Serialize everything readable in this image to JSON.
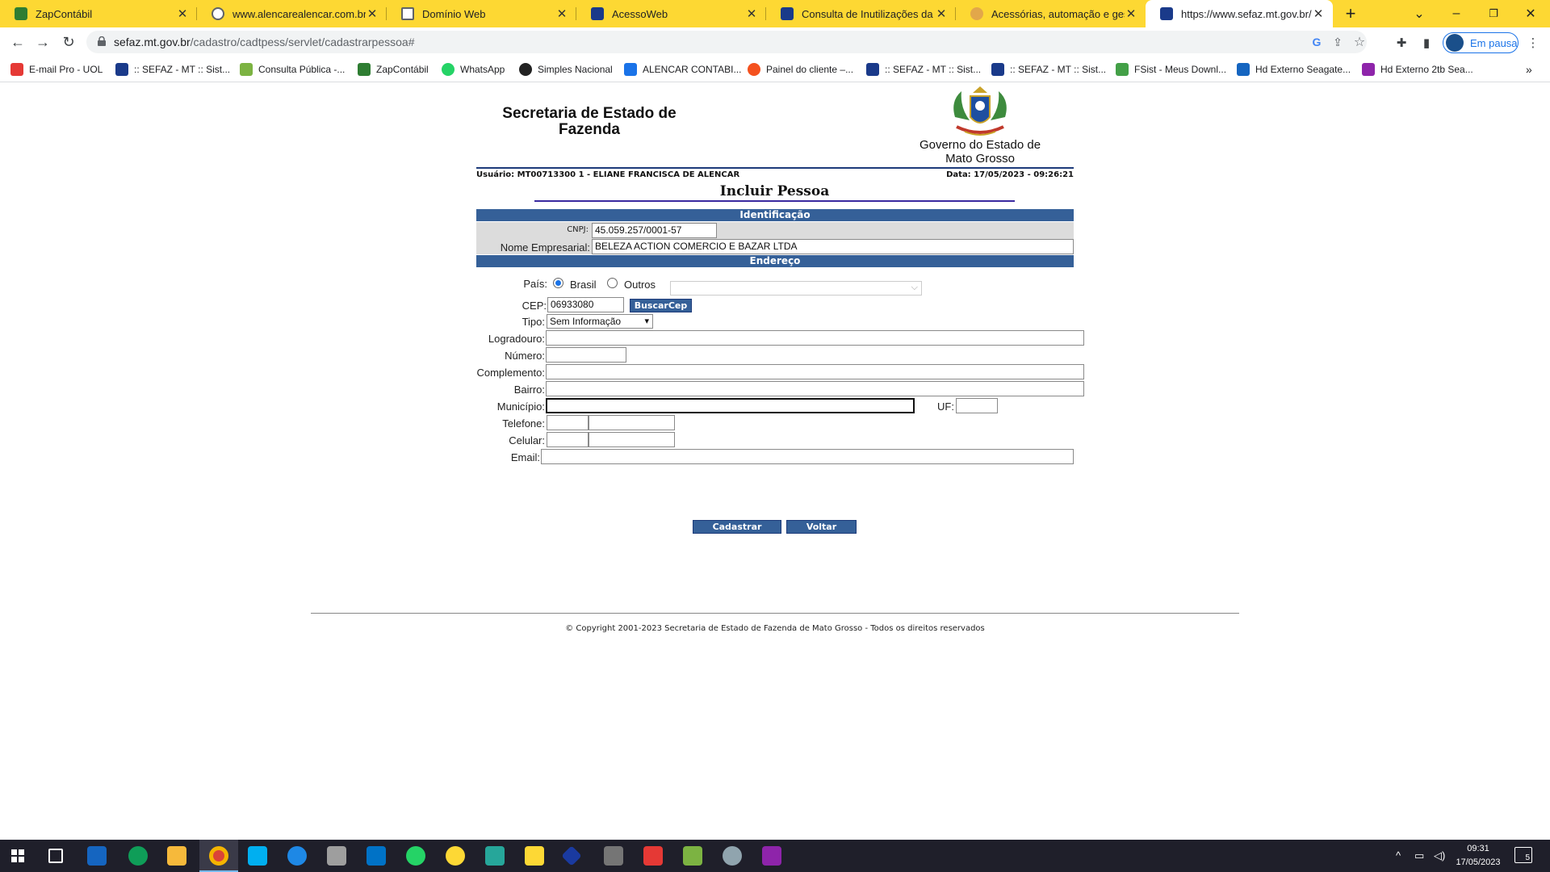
{
  "browser": {
    "tabs": [
      {
        "title": "ZapContábil",
        "fav": "#2e7d32"
      },
      {
        "title": "www.alencarealencar.com.br/xm",
        "fav": "#5f6368"
      },
      {
        "title": "Domínio Web",
        "fav": "#5f6368"
      },
      {
        "title": "AcessoWeb",
        "fav": "#1a3a8a"
      },
      {
        "title": "Consulta de Inutilizações da NF",
        "fav": "#1a3a8a"
      },
      {
        "title": "Acessórias, automação e gestão",
        "fav": "#e2a74a"
      },
      {
        "title": "https://www.sefaz.mt.gov.br/cad",
        "fav": "#1a3a8a"
      }
    ],
    "new_tab": "+",
    "url_host": "sefaz.mt.gov.br",
    "url_path": "/cadastro/cadtpess/servlet/cadastrarpessoa#",
    "profile_status": "Em pausa",
    "bookmarks": [
      {
        "label": "E-mail Pro - UOL",
        "color": "#e53935"
      },
      {
        "label": ":: SEFAZ - MT :: Sist...",
        "color": "#1a3a8a"
      },
      {
        "label": "Consulta Pública -...",
        "color": "#7cb342"
      },
      {
        "label": "ZapContábil",
        "color": "#2e7d32"
      },
      {
        "label": "WhatsApp",
        "color": "#25d366"
      },
      {
        "label": "Simples Nacional",
        "color": "#222222"
      },
      {
        "label": "ALENCAR CONTABI...",
        "color": "#1a73e8"
      },
      {
        "label": "Painel do cliente –...",
        "color": "#f4511e"
      },
      {
        "label": ":: SEFAZ - MT :: Sist...",
        "color": "#1a3a8a"
      },
      {
        "label": ":: SEFAZ - MT :: Sist...",
        "color": "#1a3a8a"
      },
      {
        "label": "FSist - Meus Downl...",
        "color": "#43a047"
      },
      {
        "label": "Hd Externo Seagate...",
        "color": "#1565c0"
      },
      {
        "label": "Hd Externo 2tb Sea...",
        "color": "#8e24aa"
      }
    ],
    "bookmarks_more": "»"
  },
  "page": {
    "header_title": "Secretaria de Estado de Fazenda",
    "gov_name": "Governo do Estado de Mato Grosso",
    "user": "Usuário: MT00713300 1 - ELIANE FRANCISCA DE ALENCAR",
    "date": "Data: 17/05/2023 - 09:26:21",
    "title": "Incluir Pessoa",
    "section_id": "Identificação",
    "cnpj_label": "CNPJ:",
    "cnpj_value": "45.059.257/0001-57",
    "nome_label": "Nome Empresarial:",
    "nome_value": "BELEZA ACTION COMERCIO E BAZAR LTDA",
    "section_end": "Endereço",
    "pais_label": "País:",
    "pais_brasil": "Brasil",
    "pais_outros": "Outros",
    "cep_label": "CEP:",
    "cep_value": "06933080",
    "buscar_cep": "BuscarCep",
    "tipo_label": "Tipo:",
    "tipo_value": "Sem Informação",
    "logradouro_label": "Logradouro:",
    "numero_label": "Número:",
    "complemento_label": "Complemento:",
    "bairro_label": "Bairro:",
    "municipio_label": "Município:",
    "uf_label": "UF:",
    "telefone_label": "Telefone:",
    "celular_label": "Celular:",
    "email_label": "Email:",
    "cadastrar": "Cadastrar",
    "voltar": "Voltar",
    "copyright": "© Copyright 2001-2023 Secretaria de Estado de Fazenda de Mato Grosso - Todos os direitos reservados"
  },
  "taskbar": {
    "time": "09:31",
    "date": "17/05/2023",
    "notifications": "5"
  }
}
